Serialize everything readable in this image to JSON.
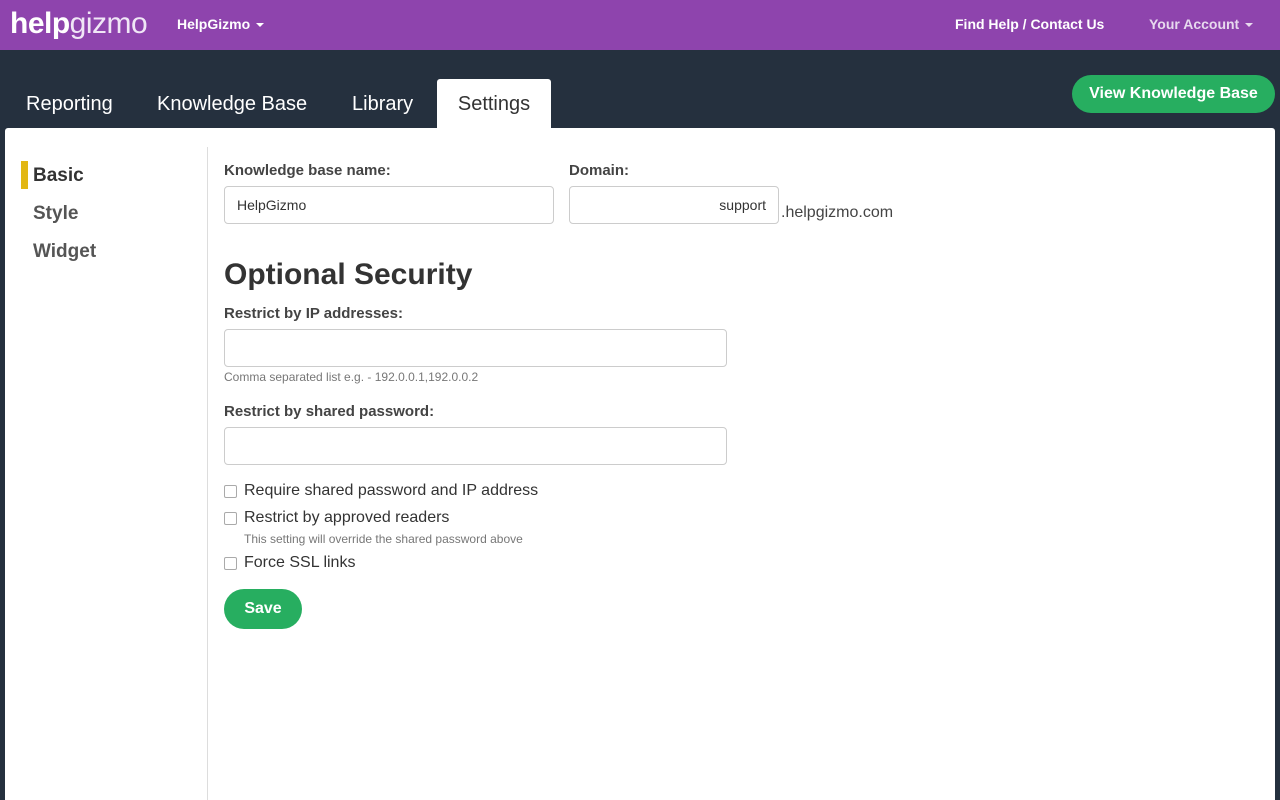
{
  "header": {
    "logo_bold": "help",
    "logo_light": "gizmo",
    "org_switcher": "HelpGizmo",
    "find_help": "Find Help / Contact Us",
    "account": "Your Account"
  },
  "tabs": [
    {
      "label": "Reporting",
      "active": false
    },
    {
      "label": "Knowledge Base",
      "active": false
    },
    {
      "label": "Library",
      "active": false
    },
    {
      "label": "Settings",
      "active": true
    }
  ],
  "view_kb_button": "View Knowledge Base",
  "sidebar": {
    "items": [
      {
        "label": "Basic",
        "active": true
      },
      {
        "label": "Style",
        "active": false
      },
      {
        "label": "Widget",
        "active": false
      }
    ]
  },
  "form": {
    "kb_name_label": "Knowledge base name:",
    "kb_name_value": "HelpGizmo",
    "domain_label": "Domain:",
    "domain_value": "support",
    "domain_suffix": ".helpgizmo.com",
    "security_heading": "Optional Security",
    "ip_label": "Restrict by IP addresses:",
    "ip_value": "",
    "ip_help": "Comma separated list e.g. - 192.0.0.1,192.0.0.2",
    "password_label": "Restrict by shared password:",
    "password_value": "",
    "checkboxes": [
      {
        "label": "Require shared password and IP address",
        "checked": false
      },
      {
        "label": "Restrict by approved readers",
        "checked": false,
        "help": "This setting will override the shared password above"
      },
      {
        "label": "Force SSL links",
        "checked": false
      }
    ],
    "save_label": "Save"
  },
  "colors": {
    "topbar": "#8e44ad",
    "nav_background": "#25303e",
    "accent_green": "#27ae60",
    "sidebar_marker": "#e2b714"
  }
}
